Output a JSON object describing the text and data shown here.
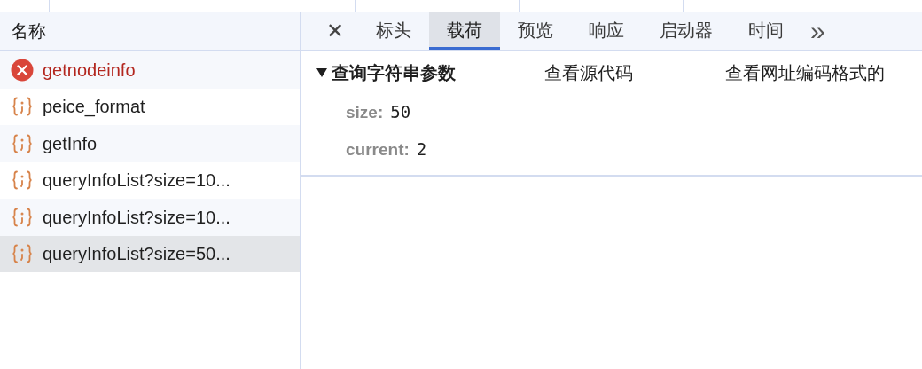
{
  "requests": {
    "column": "名称",
    "rows": [
      {
        "name": "getnodeinfo",
        "kind": "error",
        "selected": false
      },
      {
        "name": "peice_format",
        "kind": "fetch",
        "selected": false
      },
      {
        "name": "getInfo",
        "kind": "fetch",
        "selected": false
      },
      {
        "name": "queryInfoList?size=10...",
        "kind": "fetch",
        "selected": false
      },
      {
        "name": "queryInfoList?size=10...",
        "kind": "fetch",
        "selected": false
      },
      {
        "name": "queryInfoList?size=50...",
        "kind": "fetch",
        "selected": true
      }
    ]
  },
  "details": {
    "close": "✕",
    "tabs": [
      {
        "label": "标头",
        "selected": false
      },
      {
        "label": "载荷",
        "selected": true
      },
      {
        "label": "预览",
        "selected": false
      },
      {
        "label": "响应",
        "selected": false
      },
      {
        "label": "启动器",
        "selected": false
      },
      {
        "label": "时间",
        "selected": false
      }
    ],
    "more": "»",
    "section": {
      "title": "查询字符串参数",
      "expanded": true,
      "view_source": "查看源代码",
      "view_encoded": "查看网址编码格式的",
      "params": [
        {
          "key": "size:",
          "value": "50"
        },
        {
          "key": "current:",
          "value": "2"
        }
      ]
    }
  }
}
